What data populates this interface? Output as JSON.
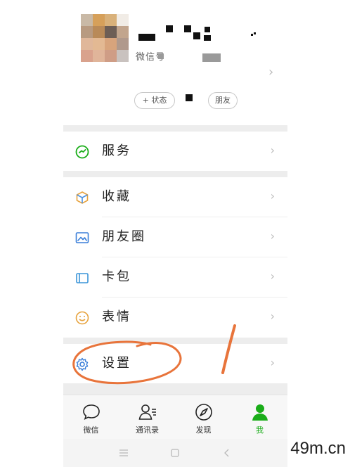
{
  "profile": {
    "wechat_id_label": "微信号",
    "status_button": "+ 状态",
    "friends_label": "朋友"
  },
  "menu": [
    {
      "id": "service",
      "label": "服务",
      "icon": "service-icon"
    },
    {
      "id": "favorites",
      "label": "收藏",
      "icon": "cube-icon"
    },
    {
      "id": "moments",
      "label": "朋友圈",
      "icon": "image-icon"
    },
    {
      "id": "cards",
      "label": "卡包",
      "icon": "wallet-icon"
    },
    {
      "id": "stickers",
      "label": "表情",
      "icon": "smiley-icon"
    },
    {
      "id": "settings",
      "label": "设置",
      "icon": "gear-icon"
    }
  ],
  "tabs": [
    {
      "label": "微信",
      "icon": "chat-bubble-icon"
    },
    {
      "label": "通讯录",
      "icon": "contacts-icon"
    },
    {
      "label": "发现",
      "icon": "compass-icon"
    },
    {
      "label": "我",
      "icon": "person-icon",
      "active": true
    }
  ],
  "chevron": "›",
  "watermark": "49m.cn",
  "colors": {
    "accent": "#1aad19",
    "annotation": "#e8743b",
    "separator": "#ededed"
  }
}
